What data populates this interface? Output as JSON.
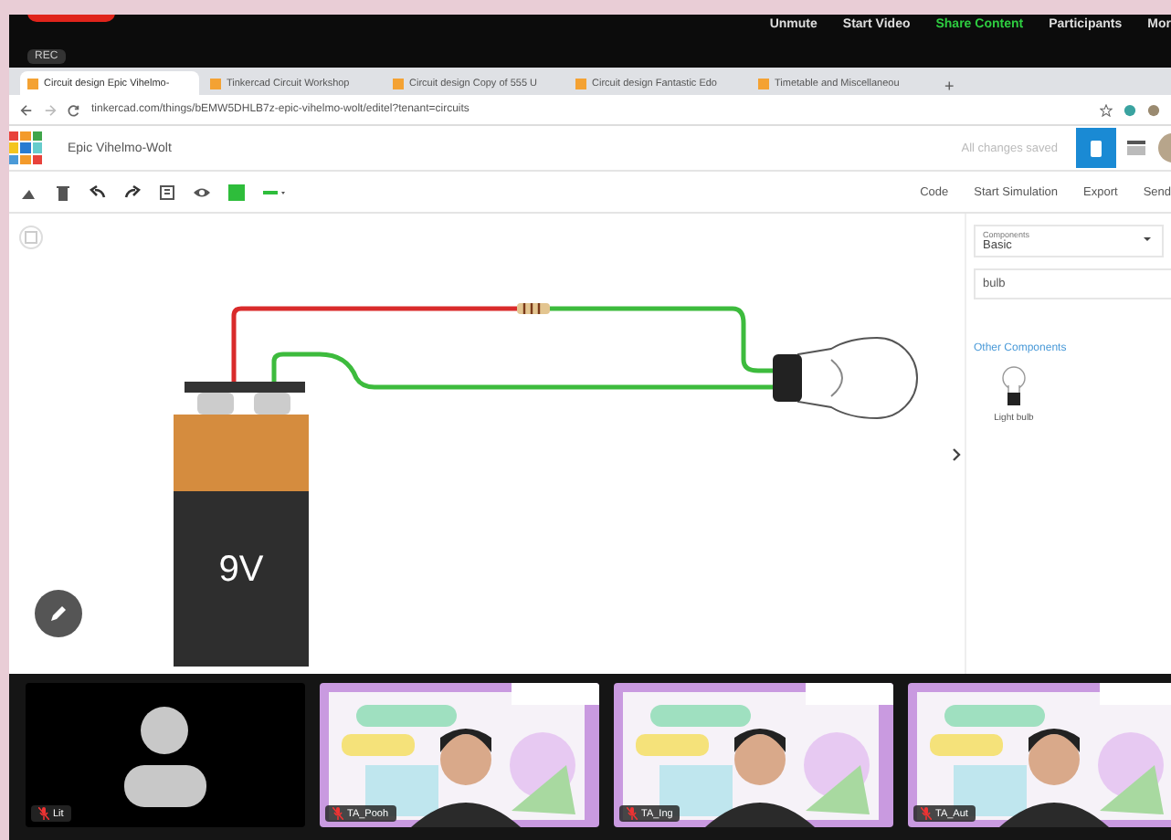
{
  "zoom_bar": {
    "rec": "REC",
    "controls": [
      {
        "label": "Unmute",
        "highlighted": false
      },
      {
        "label": "Start Video",
        "highlighted": false
      },
      {
        "label": "Share Content",
        "highlighted": true
      },
      {
        "label": "Participants",
        "highlighted": false
      },
      {
        "label": "Mor",
        "highlighted": false
      }
    ]
  },
  "browser": {
    "tabs": [
      {
        "title": "Circuit design Epic Vihelmo-",
        "selected": true
      },
      {
        "title": "Tinkercad Circuit Workshop",
        "selected": false
      },
      {
        "title": "Circuit design Copy of 555 U",
        "selected": false
      },
      {
        "title": "Circuit design Fantastic Edo",
        "selected": false
      },
      {
        "title": "Timetable and Miscellaneou",
        "selected": false
      }
    ],
    "new_tab": "+",
    "url": "tinkercad.com/things/bEMW5DHLB7z-epic-vihelmo-wolt/editel?tenant=circuits"
  },
  "app": {
    "title": "Epic Vihelmo-Wolt",
    "save_status": "All changes saved",
    "actions": [
      "Code",
      "Start Simulation",
      "Export",
      "Send"
    ]
  },
  "canvas": {
    "battery_label": "9V"
  },
  "components_panel": {
    "category_label": "Components",
    "category": "Basic",
    "search": "bulb",
    "section": "Other Components",
    "items": [
      {
        "label": "Light bulb"
      }
    ]
  },
  "videos": [
    {
      "kind": "avatar",
      "name": "Lit",
      "muted": true
    },
    {
      "kind": "camera",
      "name": "TA_Pooh",
      "muted": true
    },
    {
      "kind": "camera",
      "name": "TA_Ing",
      "muted": true
    },
    {
      "kind": "camera",
      "name": "TA_Aut",
      "muted": true
    }
  ]
}
